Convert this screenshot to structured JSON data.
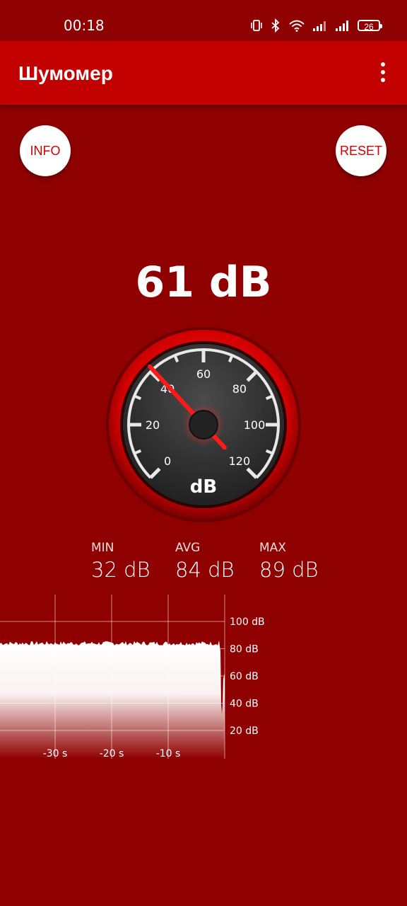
{
  "status_bar": {
    "time": "00:18",
    "battery": "26",
    "icons": [
      "vibrate-icon",
      "bluetooth-icon",
      "wifi-icon",
      "signal-icon",
      "signal-icon",
      "battery-icon"
    ]
  },
  "app_bar": {
    "title": "Шумомер",
    "menu_icon": "more-vert-icon"
  },
  "buttons": {
    "info": "INFO",
    "reset": "RESET"
  },
  "reading": "61 dB",
  "gauge": {
    "unit": "dB",
    "value": 61,
    "needle_value": 41,
    "min": 0,
    "max": 120,
    "labels": [
      "0",
      "20",
      "40",
      "60",
      "80",
      "100",
      "120"
    ]
  },
  "stats": {
    "min_label": "MIN",
    "min_value": "32 dB",
    "avg_label": "AVG",
    "avg_value": "84 dB",
    "max_label": "MAX",
    "max_value": "89 dB"
  },
  "graph": {
    "y_labels": [
      "100 dB",
      "80 dB",
      "60 dB",
      "40 dB",
      "20 dB"
    ],
    "x_labels": [
      "-30 s",
      "-20 s",
      "-10 s"
    ]
  },
  "colors": {
    "background": "#8f0000",
    "app_bar": "#c20000",
    "accent": "#e00000",
    "needle": "#ff1a1a"
  }
}
